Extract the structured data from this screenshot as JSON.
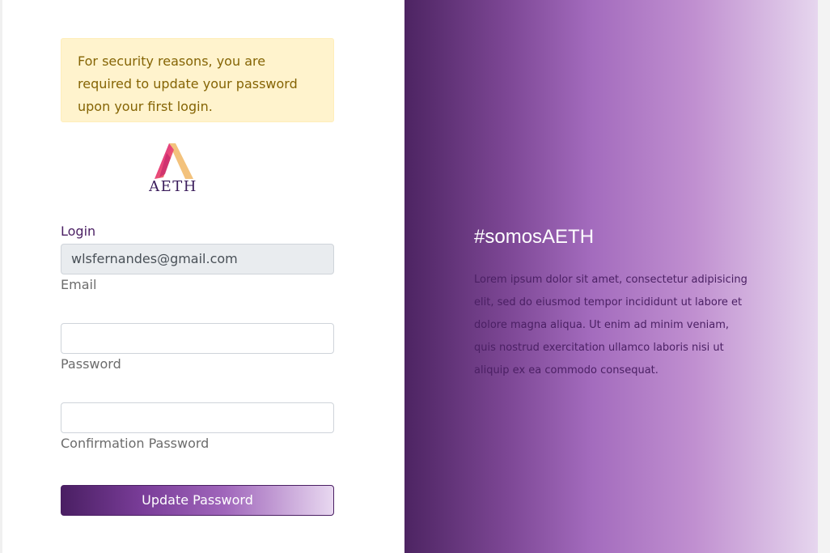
{
  "alert": {
    "message": "For security reasons, you are required to update your password upon your first login."
  },
  "brand": {
    "logo_text": "AETH",
    "logo_icon": "aeth-logo-icon"
  },
  "form": {
    "login_label": "Login",
    "email_value": "wlsfernandes@gmail.com",
    "email_helper": "Email",
    "password_value": "",
    "password_helper": "Password",
    "confirm_value": "",
    "confirm_helper": "Confirmation Password",
    "submit_label": "Update Password"
  },
  "hero": {
    "tagline": "#somosAETH",
    "body": "Lorem ipsum dolor sit amet, consectetur adipisicing elit, sed do eiusmod tempor incididunt ut labore et dolore magna aliqua. Ut enim ad minim veniam, quis nostrud exercitation ullamco laboris nisi ut aliquip ex ea commodo consequat."
  },
  "colors": {
    "brand_purple": "#4a1f63",
    "alert_bg": "#fff3cd",
    "alert_text": "#856404",
    "gradient_start": "#4d2462",
    "gradient_end": "#e6d6ee"
  }
}
